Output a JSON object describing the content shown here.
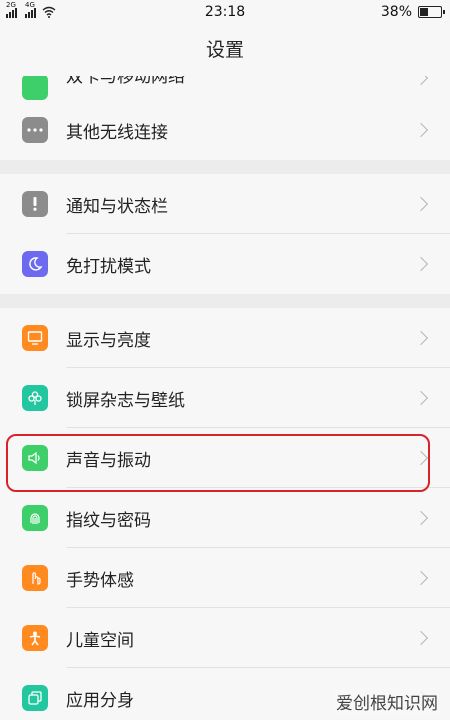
{
  "status_bar": {
    "signal1_tag": "2G",
    "signal2_tag": "4G",
    "time": "23:18",
    "battery_text": "38%",
    "battery_level": 0.38
  },
  "header": {
    "title": "设置"
  },
  "rows": {
    "mobile_network": {
      "label": "双卡与移动网络",
      "icon": "sim-icon",
      "color": "#3ecf6a"
    },
    "other_wireless": {
      "label": "其他无线连接",
      "icon": "more-icon",
      "color": "#8c8c8c"
    },
    "notification": {
      "label": "通知与状态栏",
      "icon": "exclamation-icon",
      "color": "#8c8c8c"
    },
    "dnd": {
      "label": "免打扰模式",
      "icon": "moon-icon",
      "color": "#6e6af0"
    },
    "display": {
      "label": "显示与亮度",
      "icon": "monitor-icon",
      "color": "#ff8a1f"
    },
    "lockscreen": {
      "label": "锁屏杂志与壁纸",
      "icon": "flower-icon",
      "color": "#22c7a0"
    },
    "sound": {
      "label": "声音与振动",
      "icon": "speaker-icon",
      "color": "#3ecf6a"
    },
    "fingerprint": {
      "label": "指纹与密码",
      "icon": "fingerprint-icon",
      "color": "#3ecf6a"
    },
    "gesture": {
      "label": "手势体感",
      "icon": "hand-icon",
      "color": "#ff8a1f"
    },
    "kids": {
      "label": "儿童空间",
      "icon": "child-icon",
      "color": "#ff8a1f"
    },
    "clone": {
      "label": "应用分身",
      "icon": "clone-icon",
      "color": "#22c7a0"
    }
  },
  "watermark": "爱创根知识网"
}
